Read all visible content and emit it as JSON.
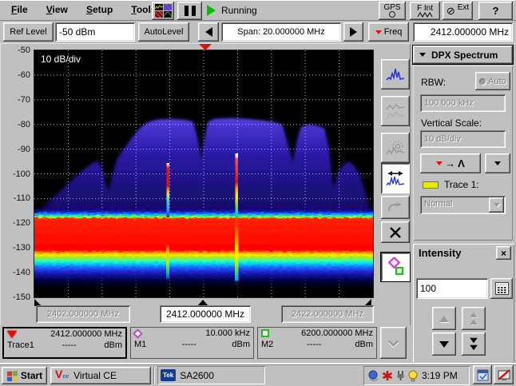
{
  "menu": {
    "items": [
      "File",
      "View",
      "Setup",
      "Tools"
    ],
    "status": "Running"
  },
  "top_buttons": {
    "gps": "GPS",
    "f_int": "F Int",
    "ext": "Ext",
    "help": "?"
  },
  "toolbar": {
    "ref_level_label": "Ref Level",
    "ref_level_value": "-50 dBm",
    "autolevel_label": "AutoLevel",
    "span_value": "Span:  20.000000 MHz",
    "freq_label": "Freq",
    "center_freq_value": "2412.000000 MHz"
  },
  "display": {
    "scale_label": "10 dB/div",
    "y_ticks": [
      "-50",
      "-60",
      "-70",
      "-80",
      "-90",
      "-100",
      "-110",
      "-120",
      "-130",
      "-140",
      "-150"
    ],
    "freq_labels": {
      "left": "2402.000000 MHz",
      "center": "2412.000000 MHz",
      "right": "2422.000000 MHz"
    }
  },
  "sidebar": {
    "title": "DPX Spectrum",
    "rbw_label": "RBW:",
    "rbw_auto_label": "Auto",
    "rbw_value": "100.000 kHz",
    "vertical_scale_label": "Vertical Scale:",
    "vertical_scale_value": "10 dB/div",
    "trace_label": "Trace 1:",
    "trace_mode_value": "Normal"
  },
  "intensity": {
    "title": "Intensity",
    "value": "100"
  },
  "markers": [
    {
      "freq": "2412.000000 MHz",
      "name": "Trace1",
      "amplitude": "-----",
      "unit": "dBm"
    },
    {
      "freq": "10.000 kHz",
      "name": "M1",
      "amplitude": "-----",
      "unit": "dBm"
    },
    {
      "freq": "6200.000000 MHz",
      "name": "M2",
      "amplitude": "-----",
      "unit": "dBm"
    }
  ],
  "taskbar": {
    "start_label": "Start",
    "virtual_ce_label": "Virtual CE",
    "app_label": "SA2600",
    "tek_label": "Tek",
    "time": "3:19 PM"
  },
  "colors": {
    "accent_red": "#dd1111",
    "marker_magenta": "#cc44cc",
    "marker_green": "#22bb22",
    "trace_yellow": "#e8e800",
    "running_green": "#00c000"
  },
  "spectrum": {
    "center_frequency_mhz": 2412.0,
    "span_mhz": 20.0,
    "ref_level_dbm": -50,
    "scale_db_per_div": 10,
    "noise_band_red_core_dbm": [
      -118,
      -131
    ],
    "noise_band_top_dbm": -116,
    "noise_band_bottom_dbm": -144,
    "wifi_hump_top_dbm": -79,
    "narrow_peaks_mhz": [
      2410,
      2414
    ],
    "narrow_peak_tops_dbm": [
      -96,
      -92
    ]
  }
}
